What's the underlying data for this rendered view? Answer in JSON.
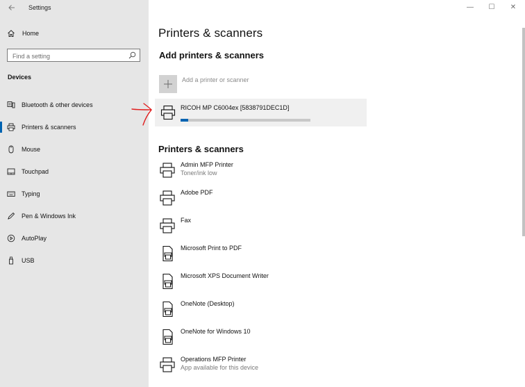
{
  "window": {
    "back_icon": "back-arrow-icon",
    "title": "Settings",
    "minimize": "—",
    "maximize": "☐",
    "close": "✕"
  },
  "sidebar": {
    "home_label": "Home",
    "search_placeholder": "Find a setting",
    "section": "Devices",
    "items": [
      {
        "label": "Bluetooth & other devices",
        "icon": "bluetooth-devices-icon"
      },
      {
        "label": "Printers & scanners",
        "icon": "printer-icon",
        "active": true
      },
      {
        "label": "Mouse",
        "icon": "mouse-icon"
      },
      {
        "label": "Touchpad",
        "icon": "touchpad-icon"
      },
      {
        "label": "Typing",
        "icon": "keyboard-icon"
      },
      {
        "label": "Pen & Windows Ink",
        "icon": "pen-icon"
      },
      {
        "label": "AutoPlay",
        "icon": "autoplay-icon"
      },
      {
        "label": "USB",
        "icon": "usb-icon"
      }
    ]
  },
  "main": {
    "title": "Printers & scanners",
    "add_section": "Add printers & scanners",
    "add_button_label": "Add a printer or scanner",
    "found_device": {
      "name": "RICOH MP C6004ex [5838791DEC1D]",
      "progress_fraction": 0.06
    },
    "list_title": "Printers & scanners",
    "printers": [
      {
        "name": "Admin MFP Printer",
        "status": "Toner/ink low",
        "icon": "printer-icon"
      },
      {
        "name": "Adobe PDF",
        "status": "",
        "icon": "printer-icon"
      },
      {
        "name": "Fax",
        "status": "",
        "icon": "printer-icon"
      },
      {
        "name": "Microsoft Print to PDF",
        "status": "",
        "icon": "document-printer-icon"
      },
      {
        "name": "Microsoft XPS Document Writer",
        "status": "",
        "icon": "document-printer-icon"
      },
      {
        "name": "OneNote (Desktop)",
        "status": "",
        "icon": "document-printer-icon"
      },
      {
        "name": "OneNote for Windows 10",
        "status": "",
        "icon": "document-printer-icon"
      },
      {
        "name": "Operations MFP Printer",
        "status": "App available for this device",
        "icon": "printer-icon"
      }
    ]
  },
  "colors": {
    "sidebar_bg": "#e6e6e6",
    "accent": "#0063b1",
    "annotation": "#e02020"
  }
}
